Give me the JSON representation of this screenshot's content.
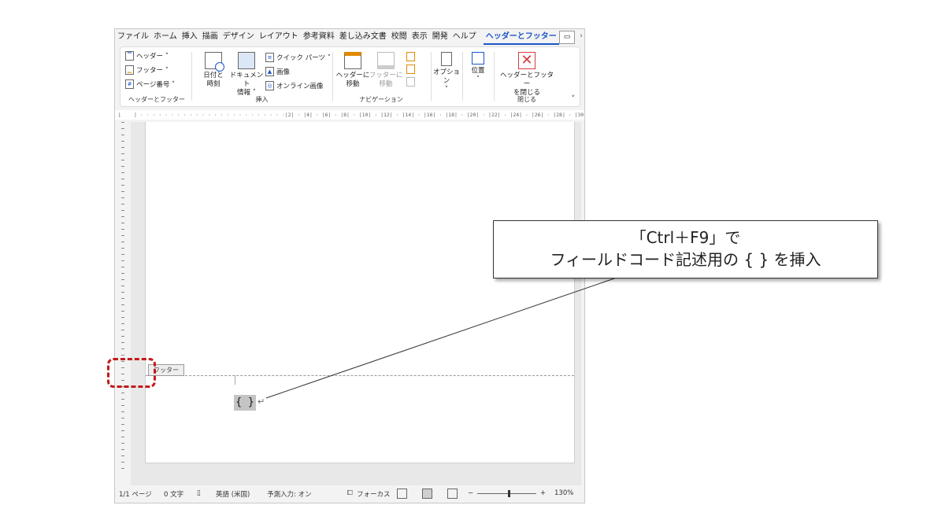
{
  "ribbon_tabs": [
    "ファイル",
    "ホーム",
    "挿入",
    "描画",
    "デザイン",
    "レイアウト",
    "参考資料",
    "差し込み文書",
    "校閲",
    "表示",
    "開発",
    "ヘルプ",
    "ヘッダーとフッター"
  ],
  "active_tab": "ヘッダーとフッター",
  "groups": {
    "hf": {
      "label": "ヘッダーとフッター",
      "header": "ヘッダー ˅",
      "footer": "フッター ˅",
      "page_number": "ページ番号 ˅"
    },
    "insert": {
      "label": "挿入",
      "datetime": [
        "日付と",
        "時刻"
      ],
      "docinfo": [
        "ドキュメント",
        "情報 ˅"
      ],
      "quickparts": "クイック パーツ ˅",
      "picture": "画像",
      "online_picture": "オンライン画像"
    },
    "nav": {
      "label": "ナビゲーション",
      "goto_header": [
        "ヘッダーに",
        "移動"
      ],
      "goto_footer": [
        "フッターに",
        "移動"
      ]
    },
    "options": {
      "label": "オプション",
      "arrow": "˅"
    },
    "position": {
      "label": "位置",
      "arrow": "˅"
    },
    "close": {
      "label": "閉じる",
      "button": [
        "ヘッダーとフッター",
        "を閉じる"
      ]
    }
  },
  "ruler_text": "| · · · · · · · · · · · · · · · · · · · · · · · ·|2| · |4| · |6| · |8| · |10| · |12| · |14| · |16| · |18| · |20| · |22| · |24| · |26| · |28| · |30",
  "footer_tag": "フッター",
  "field_code": "{ }",
  "paragraph_mark": "↵",
  "status": {
    "page": "1/1 ページ",
    "words": "0 文字",
    "language": "英語 (米国)",
    "ime": "予測入力: オン",
    "focus": "フォーカス",
    "zoom": "130%",
    "zoom_minus": "−",
    "zoom_plus": "+"
  },
  "callout": {
    "line1": "「Ctrl＋F9」で",
    "line2": "フィールドコード記述用の { } を挿入"
  },
  "colors": {
    "accent": "#1a56c8",
    "highlight": "#c41a1a",
    "close_icon": "#d83a3a"
  }
}
